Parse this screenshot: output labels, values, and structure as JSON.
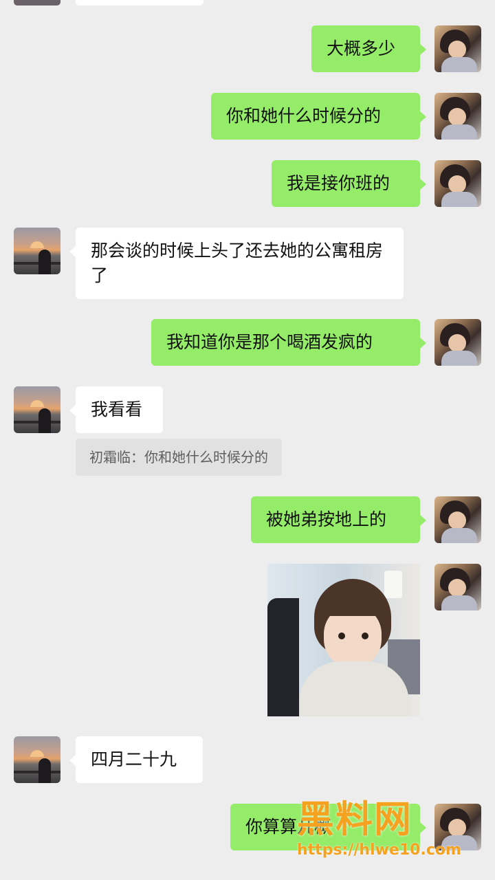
{
  "chat": {
    "messages": [
      {
        "from": "me",
        "text": "大概多少"
      },
      {
        "from": "me",
        "text": "你和她什么时候分的"
      },
      {
        "from": "me",
        "text": "我是接你班的"
      },
      {
        "from": "them",
        "text": "那会谈的时候上头了还去她的公寓租房了"
      },
      {
        "from": "me",
        "text": "我知道你是那个喝酒发疯的"
      },
      {
        "from": "them",
        "text": "我看看"
      },
      {
        "from": "me",
        "text": "被她弟按地上的"
      },
      {
        "from": "them",
        "text": "四月二十九"
      },
      {
        "from": "me",
        "text": "你算算几概"
      }
    ],
    "quote": "初霜临：你和她什么时候分的"
  },
  "watermark": {
    "logo": "黑料网",
    "url": "https://hlwe10.com"
  }
}
